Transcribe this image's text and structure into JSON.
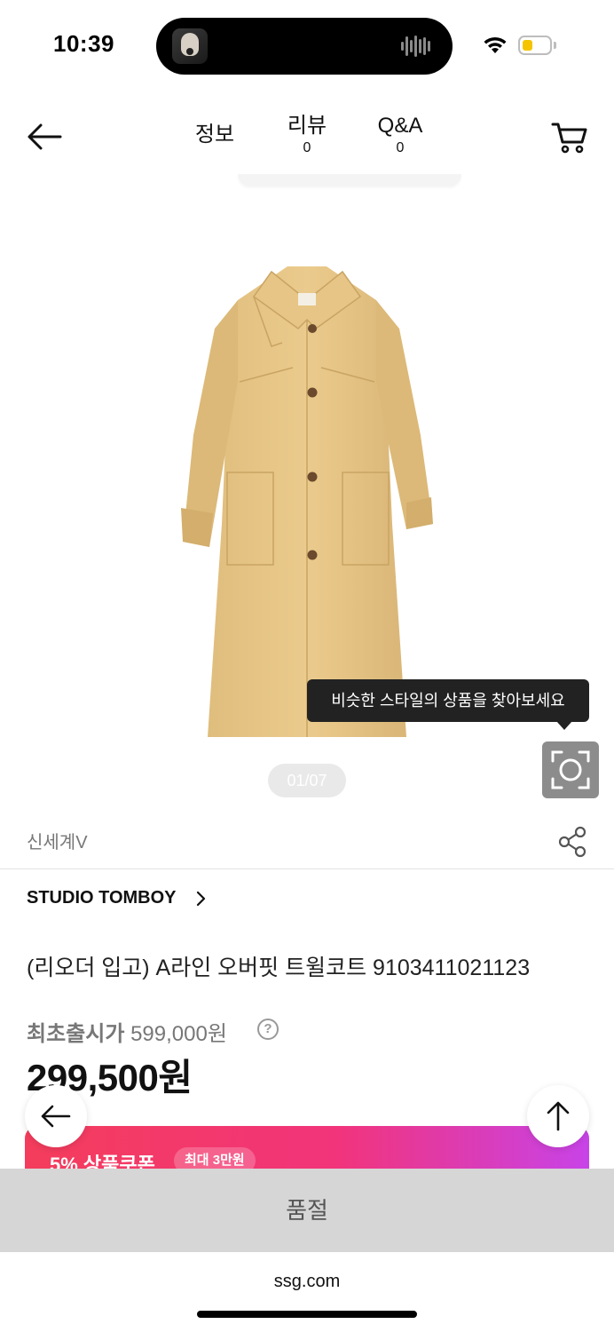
{
  "status_bar": {
    "time": "10:39",
    "battery_color": "#f5c400",
    "wifi_icon": "wifi-icon",
    "battery_icon": "battery-icon"
  },
  "header": {
    "back_icon": "arrow-left-icon",
    "tabs": [
      {
        "label": "정보",
        "count": ""
      },
      {
        "label": "리뷰",
        "count": "0"
      },
      {
        "label": "Q&A",
        "count": "0"
      }
    ],
    "cart_icon": "cart-icon"
  },
  "gallery": {
    "counter": "01/07",
    "tooltip": "비슷한 스타일의 상품을 찾아보세요",
    "visual_search_icon": "camera-scan-icon",
    "coat_color": "#e6c585"
  },
  "seller": {
    "name": "신세계V",
    "share_icon": "share-icon"
  },
  "product": {
    "brand": "STUDIO TOMBOY",
    "title": "(리오더 입고) A라인 오버핏 트윌코트 9103411021123",
    "original_price_label": "최초출시가",
    "original_price": "599,000원",
    "help_icon": "?",
    "sale_price": "299,500원"
  },
  "coupon": {
    "text": "5% 상품쿠폰",
    "badge": "최대 3만원",
    "gradient_start": "#f43d5c",
    "gradient_end": "#c843e8"
  },
  "floating": {
    "back_icon": "arrow-left-icon",
    "top_icon": "arrow-up-icon"
  },
  "action": {
    "soldout_label": "품절"
  },
  "browser": {
    "url": "ssg.com"
  }
}
